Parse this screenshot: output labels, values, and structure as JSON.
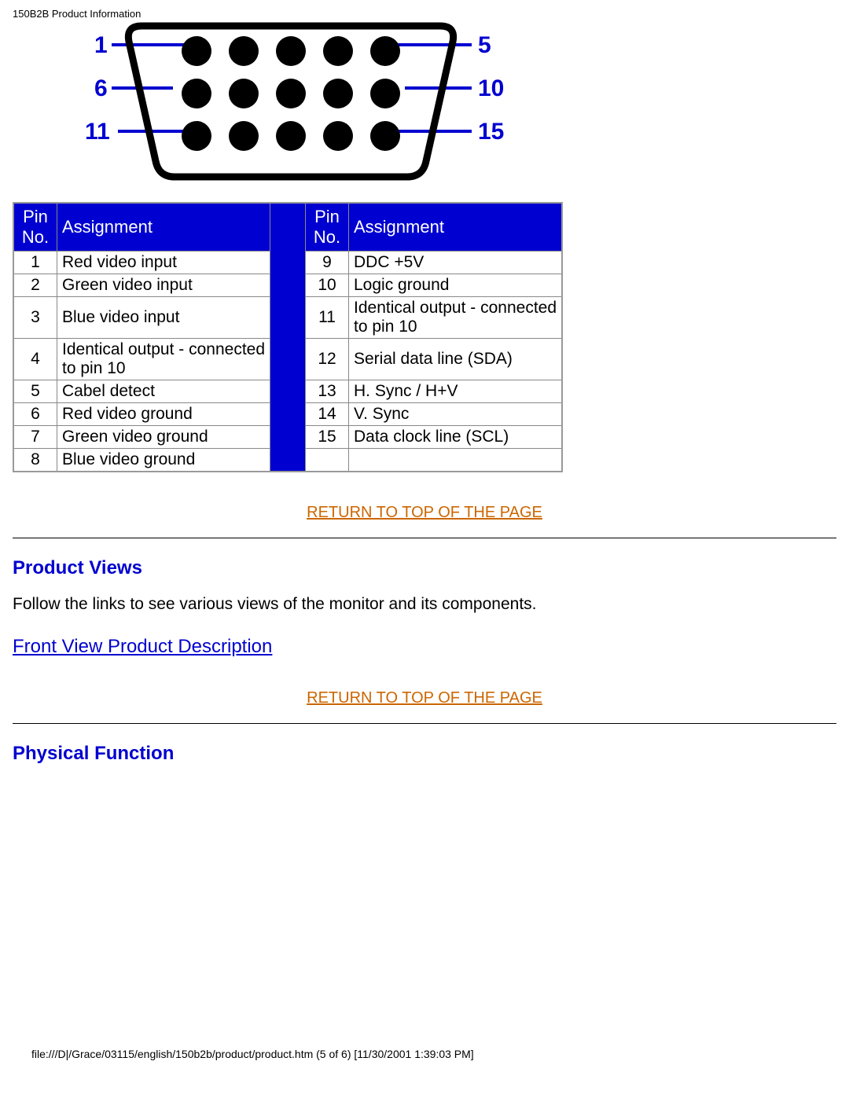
{
  "header": "150B2B Product Information",
  "diagram": {
    "labels_left": [
      "1",
      "6",
      "11"
    ],
    "labels_right": [
      "5",
      "10",
      "15"
    ]
  },
  "pin_table": {
    "col1_header": "Pin No.",
    "col2_header": "Assignment",
    "col3_header": "Pin No.",
    "col4_header": "Assignment",
    "rows": [
      {
        "l_no": "1",
        "l_txt": "Red video input",
        "r_no": "9",
        "r_txt": "DDC +5V"
      },
      {
        "l_no": "2",
        "l_txt": "Green video input",
        "r_no": "10",
        "r_txt": "Logic ground"
      },
      {
        "l_no": "3",
        "l_txt": "Blue video input",
        "r_no": "11",
        "r_txt": "Identical output - connected to pin 10"
      },
      {
        "l_no": "4",
        "l_txt": "Identical output - connected to pin 10",
        "r_no": "12",
        "r_txt": "Serial data line (SDA)"
      },
      {
        "l_no": "5",
        "l_txt": "Cabel detect",
        "r_no": "13",
        "r_txt": "H. Sync / H+V"
      },
      {
        "l_no": "6",
        "l_txt": "Red video ground",
        "r_no": "14",
        "r_txt": "V. Sync"
      },
      {
        "l_no": "7",
        "l_txt": "Green video ground",
        "r_no": "15",
        "r_txt": "Data clock line (SCL)"
      },
      {
        "l_no": "8",
        "l_txt": "Blue video ground",
        "r_no": "",
        "r_txt": ""
      }
    ]
  },
  "return_top": "RETURN TO TOP OF THE PAGE",
  "product_views_heading": "Product Views",
  "product_views_text": "Follow the links to see various views of the monitor and its components.",
  "front_view_link": "Front View Product Description",
  "physical_function_heading": "Physical Function",
  "footer": "file:///D|/Grace/03115/english/150b2b/product/product.htm (5 of 6) [11/30/2001 1:39:03 PM]"
}
